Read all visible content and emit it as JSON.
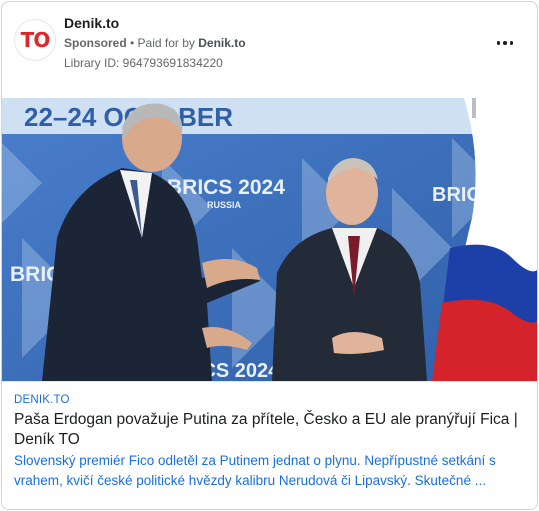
{
  "advertiser": {
    "name": "Denik.to",
    "logo_text": "TO",
    "sponsored_label": "Sponsored",
    "separator": " • ",
    "paid_for_prefix": "Paid for by ",
    "paid_for_name": "Denik.to",
    "library_id": "Library ID: 964793691834220"
  },
  "media": {
    "banner_dates": "22–24 OCTOBER",
    "event_logo": "BRICS 2024",
    "event_sub": "RUSSIA",
    "colors": {
      "backdrop": "#3a6cb6",
      "flag_white": "#ffffff",
      "flag_blue": "#1c3fa8",
      "flag_red": "#d5232b"
    }
  },
  "link": {
    "domain": "DENIK.TO",
    "title": "Paša Erdogan považuje Putina za přítele, Česko a EU ale pranýřují Fica | Deník TO",
    "description": "Slovenský premiér Fico odletěl za Putinem jednat o plynu. Nepřípustné setkání s vrahem, kvičí české politické hvězdy kalibru Nerudová či Lipavský. Skutečné ..."
  },
  "icons": {
    "more": "more-horizontal-icon"
  }
}
